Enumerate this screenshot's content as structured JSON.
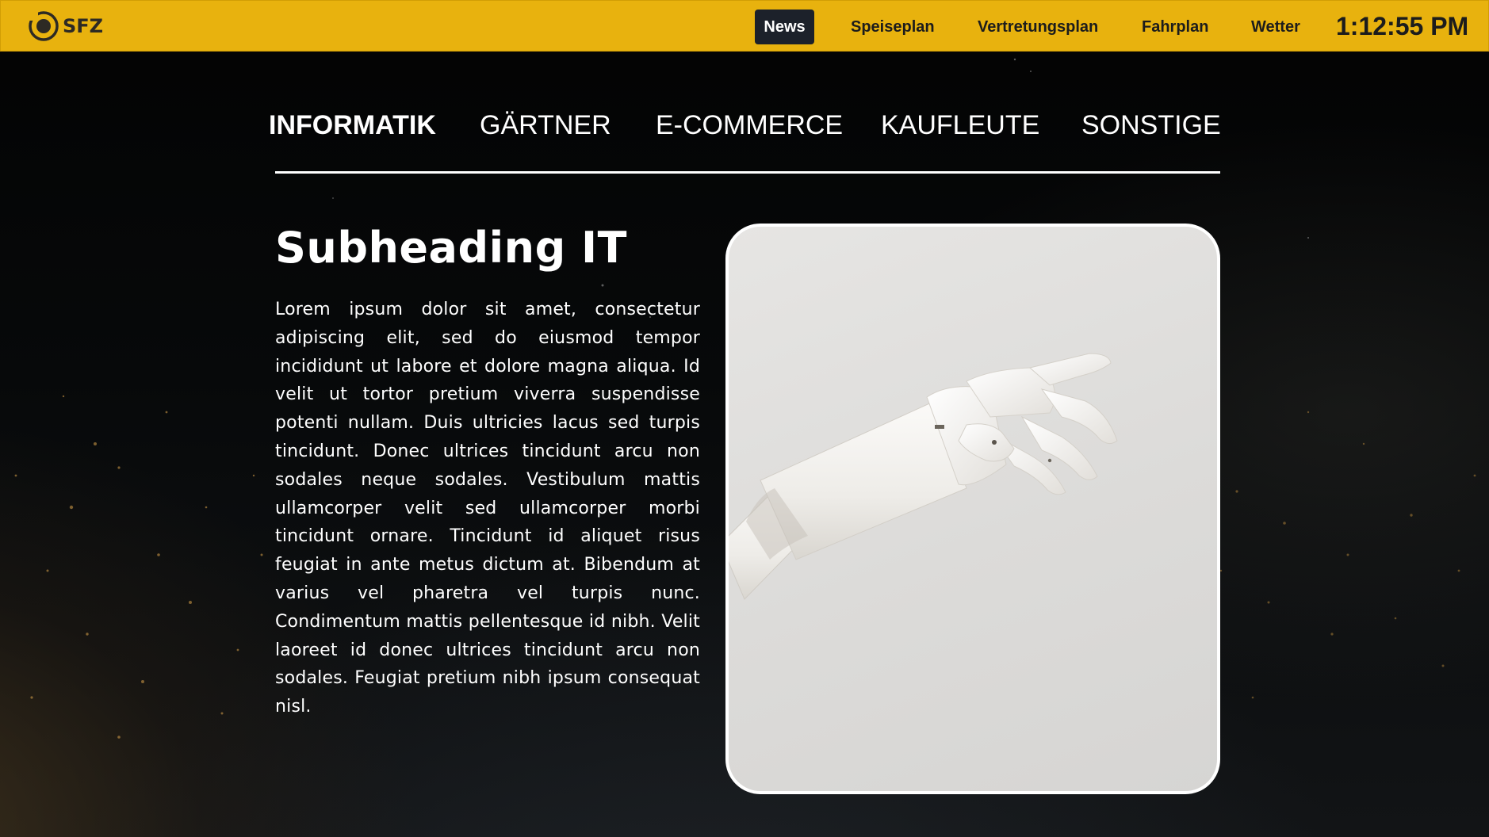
{
  "header": {
    "logo_text": "SFZ",
    "nav": [
      {
        "label": "News",
        "active": true
      },
      {
        "label": "Speiseplan",
        "active": false
      },
      {
        "label": "Vertretungsplan",
        "active": false
      },
      {
        "label": "Fahrplan",
        "active": false
      },
      {
        "label": "Wetter",
        "active": false
      }
    ],
    "clock": "1:12:55 PM",
    "bar_color": "#e8b20e"
  },
  "tabs": [
    {
      "label": "INFORMATIK",
      "active": true
    },
    {
      "label": "GÄRTNER",
      "active": false
    },
    {
      "label": "E-COMMERCE",
      "active": false
    },
    {
      "label": "KAUFLEUTE",
      "active": false
    },
    {
      "label": "SONSTIGE",
      "active": false
    }
  ],
  "content": {
    "subheading": "Subheading IT",
    "body": "Lorem ipsum dolor sit amet, consectetur adipiscing elit, sed do eiusmod tempor incididunt ut labore et dolore magna aliqua. Id velit ut tortor pretium viverra suspendisse potenti nullam. Duis ultricies lacus sed turpis tincidunt. Donec ultrices tincidunt arcu non sodales neque sodales. Vestibulum mattis ullamcorper velit sed ullamcorper morbi tincidunt ornare. Tincidunt id aliquet risus feugiat in ante metus dictum at. Bibendum at varius vel pharetra vel turpis nunc. Condimentum mattis pellentesque id nibh. Velit laoreet id donec ultrices tincidunt arcu non sodales. Feugiat pretium nibh ipsum consequat nisl.",
    "image_icon": "robot-hand-photo"
  }
}
